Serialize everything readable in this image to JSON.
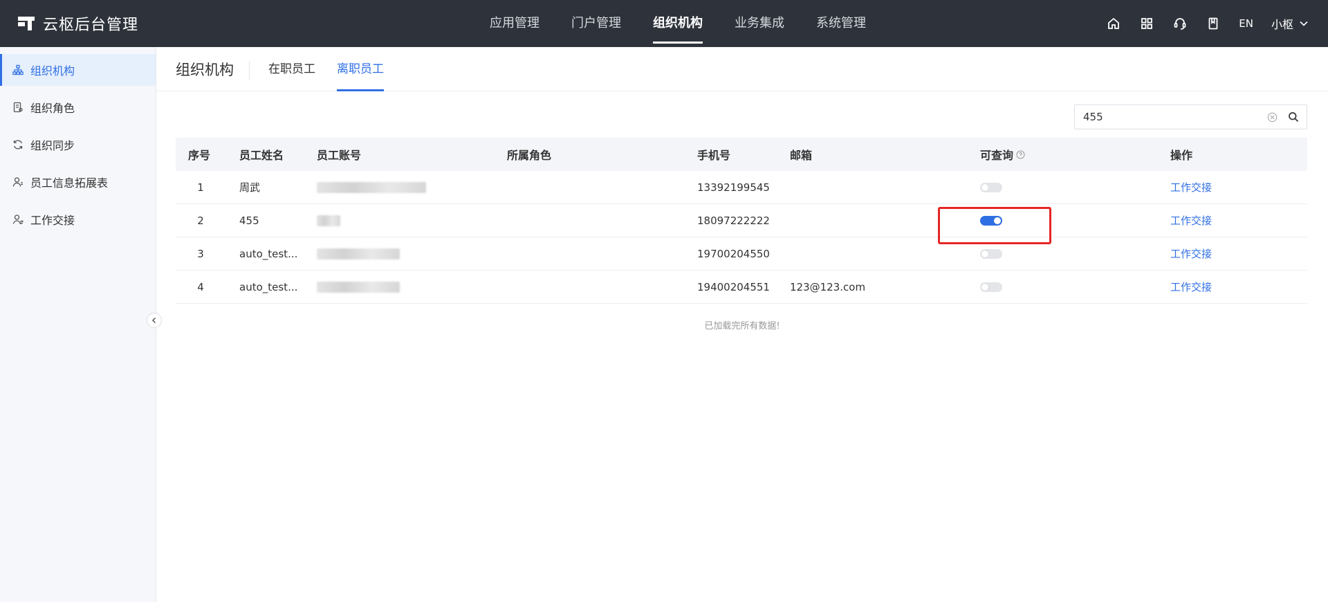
{
  "app": {
    "title": "云枢后台管理"
  },
  "topnav": {
    "items": [
      {
        "label": "应用管理",
        "active": false
      },
      {
        "label": "门户管理",
        "active": false
      },
      {
        "label": "组织机构",
        "active": true
      },
      {
        "label": "业务集成",
        "active": false
      },
      {
        "label": "系统管理",
        "active": false
      }
    ],
    "lang": "EN",
    "user": "小枢"
  },
  "sidebar": {
    "items": [
      {
        "label": "组织机构",
        "icon": "org-chart-icon",
        "active": true
      },
      {
        "label": "组织角色",
        "icon": "role-doc-icon",
        "active": false
      },
      {
        "label": "组织同步",
        "icon": "sync-icon",
        "active": false
      },
      {
        "label": "员工信息拓展表",
        "icon": "user-info-icon",
        "active": false
      },
      {
        "label": "工作交接",
        "icon": "handover-icon",
        "active": false
      }
    ]
  },
  "main": {
    "title": "组织机构",
    "tabs": [
      {
        "label": "在职员工",
        "active": false
      },
      {
        "label": "离职员工",
        "active": true
      }
    ],
    "search": {
      "value": "455"
    },
    "table": {
      "headers": {
        "index": "序号",
        "name": "员工姓名",
        "account": "员工账号",
        "role": "所属角色",
        "phone": "手机号",
        "email": "邮箱",
        "queryable": "可查询",
        "operation": "操作"
      },
      "rows": [
        {
          "index": "1",
          "name": "周武",
          "account_blur": 0.58,
          "role": "",
          "phone": "13392199545",
          "email": "",
          "queryable": false,
          "operation": "工作交接"
        },
        {
          "index": "2",
          "name": "455",
          "account_blur": 0.12,
          "role": "",
          "phone": "18097222222",
          "email": "",
          "queryable": true,
          "operation": "工作交接"
        },
        {
          "index": "3",
          "name": "auto_test...",
          "account_blur": 0.43,
          "role": "",
          "phone": "19700204550",
          "email": "",
          "queryable": false,
          "operation": "工作交接"
        },
        {
          "index": "4",
          "name": "auto_test...",
          "account_blur": 0.43,
          "role": "",
          "phone": "19400204551",
          "email": "123@123.com",
          "queryable": false,
          "operation": "工作交接"
        }
      ]
    },
    "footer_text": "已加载完所有数据!"
  },
  "colors": {
    "header_bg": "#2e333b",
    "accent": "#2f6fe4",
    "highlight": "#e52525"
  }
}
